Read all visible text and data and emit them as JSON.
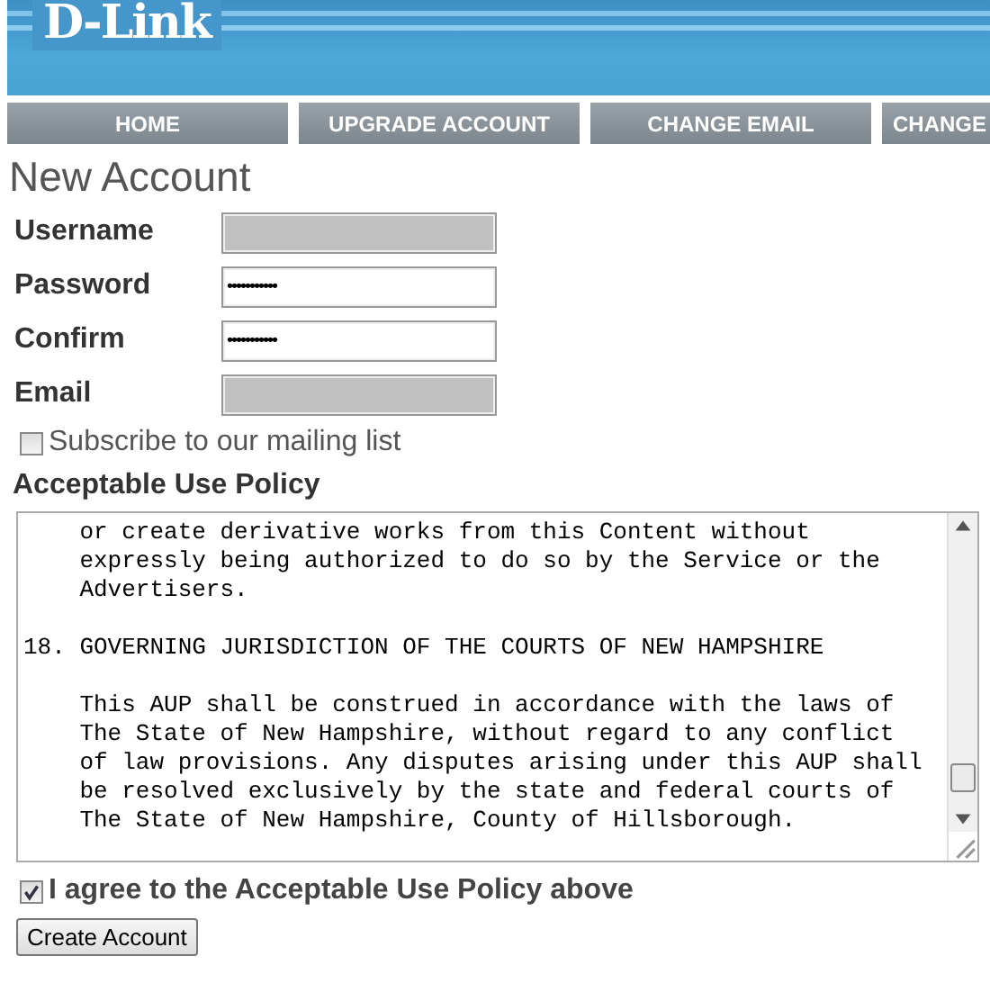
{
  "header": {
    "logo": "D-Link"
  },
  "nav": [
    {
      "label": "HOME"
    },
    {
      "label": "UPGRADE ACCOUNT"
    },
    {
      "label": "CHANGE EMAIL"
    },
    {
      "label": "CHANGE"
    }
  ],
  "title": "New Account",
  "fields": [
    {
      "label": "Username",
      "kind": "redacted"
    },
    {
      "label": "Password",
      "kind": "password",
      "value": "•••••••••••"
    },
    {
      "label": "Confirm",
      "kind": "password",
      "value": "•••••••••••"
    },
    {
      "label": "Email",
      "kind": "redacted"
    }
  ],
  "subscribe": {
    "label": "Subscribe to our mailing list",
    "checked": false
  },
  "policy": {
    "heading": "Acceptable Use Policy",
    "paragraphs": [
      {
        "lines": [
          "    or create derivative works from this Content without",
          "    expressly being authorized to do so by the Service or the",
          "    Advertisers."
        ]
      },
      {
        "lines": [
          "18. GOVERNING JURISDICTION OF THE COURTS OF NEW HAMPSHIRE"
        ]
      },
      {
        "lines": [
          "    This AUP shall be construed in accordance with the laws of",
          "    The State of New Hampshire, without regard to any conflict",
          "    of law provisions. Any disputes arising under this AUP shall",
          "    be resolved exclusively by the state and federal courts of",
          "    The State of New Hampshire, County of Hillsborough."
        ]
      }
    ]
  },
  "agree": {
    "label": "I agree to the Acceptable Use Policy above",
    "checked": true
  },
  "submit": "Create Account"
}
